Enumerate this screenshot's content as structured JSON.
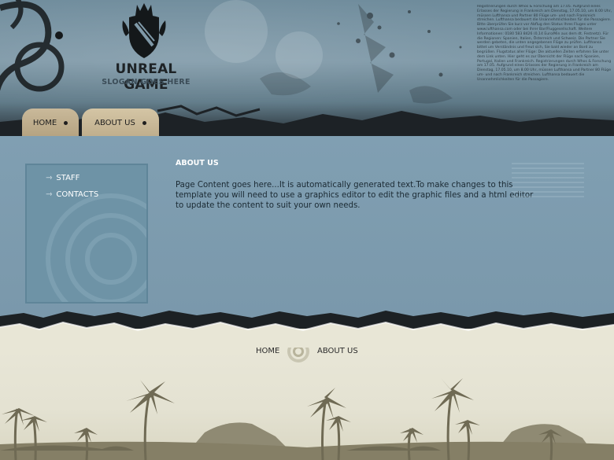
{
  "header": {
    "site_title": "UNREAL GAME",
    "slogan": "SLOGAN GOES HERE",
    "news_text": "Registrierungen durch Whos & Forschung am 17.05. Aufgrund eines Erlasses der Regierung in Frankreich am Dienstag, 17.05.10, um 8.00 Uhr, müssen Lufthansa und Partner 80 Flüge um- und nach Frankreich streichen. Lufthansa bedauert die Unannehmlichkeiten für die Passagiere. Bitte überprüfen Sie kurz vor Abflug den Status Ihres Fluges unter www.lufthansa.com oder bei Ihrer Bar/Fluggesellschaft. Weitere Informationen: 0180 583 8426 (0,14 Euro/Min aus dem dt. Festnetz). Für die Regionen: Spanien, Italien, Österreich und Schweiz. Die Partner Sie werden gebeten, die unten angegebenen Flüge zu prüfen. Lufthansa bittet um Verständnis und freut sich, Sie bald wieder an Bord zu begrüßen. Flugstatus aller Flüge: Die aktuellen Zeiten erfahren Sie unter dem Link unten. Hier geht es zur Übersicht der Flüge nach Spanien, Portugal, Italien und Frankreich. Registrierungen durch Whos & Forschung am 17.05. Aufgrund eines Erlasses der Regierung in Frankreich am Dienstag, 17.05.10, um 8.00 Uhr, müssen Lufthansa und Partner 80 Flüge um- und nach Frankreich streichen. Lufthansa bedauert die Unannehmlichkeiten für die Passagiere.",
    "tabs": [
      {
        "label": "HOME"
      },
      {
        "label": "ABOUT US"
      }
    ]
  },
  "sidebar": {
    "items": [
      {
        "label": "STAFF"
      },
      {
        "label": "CONTACTS"
      }
    ]
  },
  "content": {
    "title": "ABOUT US",
    "body": "Page Content goes here...It is automatically generated text.To make changes to this template you will need to use a graphics editor to edit the graphic files and a html editor to update the content to suit your own needs."
  },
  "footer": {
    "links": [
      {
        "label": "HOME"
      },
      {
        "label": "ABOUT US"
      }
    ]
  },
  "colors": {
    "header_blue": "#7f99a8",
    "content_blue": "#7c9aad",
    "sidebar_blue": "#6e93a6",
    "tab_tan": "#c9b99a",
    "footer_cream": "#e8e6d6"
  },
  "icons": [
    "crest-icon",
    "swirl-ornament-icon",
    "arrow-right-icon",
    "ring-separator-icon"
  ]
}
